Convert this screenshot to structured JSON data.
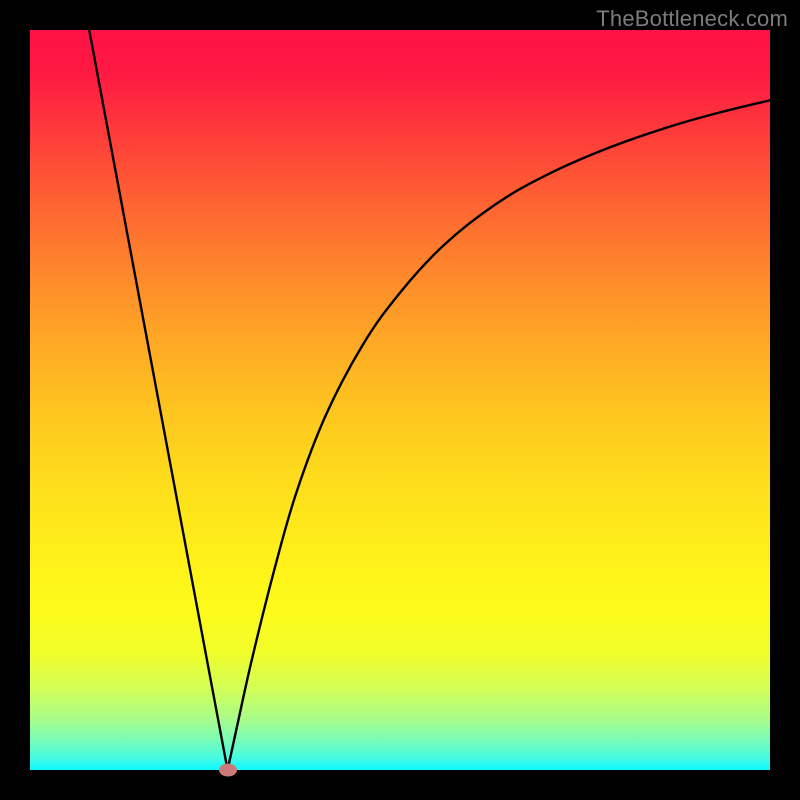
{
  "source_label": "TheBottleneck.com",
  "colors": {
    "frame_bg": "#000000",
    "gradient_top": "#fe1146",
    "gradient_bottom": "#0cf9ff",
    "curve_stroke": "#010000",
    "marker_fill": "#cb7a7b",
    "source_text": "#7c7c7c"
  },
  "chart_data": {
    "type": "line",
    "title": "",
    "xlabel": "",
    "ylabel": "",
    "xlim": [
      0,
      100
    ],
    "ylim": [
      0,
      100
    ],
    "grid": false,
    "series": [
      {
        "name": "left-segment",
        "x": [
          8,
          12,
          16,
          20,
          24,
          26.7
        ],
        "values": [
          100,
          78.6,
          57.2,
          35.8,
          14.4,
          0
        ]
      },
      {
        "name": "right-segment",
        "x": [
          26.7,
          28,
          30,
          33,
          36,
          40,
          45,
          50,
          56,
          63,
          70,
          78,
          86,
          93,
          100
        ],
        "values": [
          0,
          6,
          15,
          27,
          37.5,
          48,
          57.5,
          64.5,
          71,
          76.5,
          80.5,
          84,
          86.8,
          88.8,
          90.5
        ]
      }
    ],
    "annotations": [
      {
        "name": "vertex-marker",
        "x": 26.7,
        "y": 0,
        "kind": "point"
      }
    ],
    "background": {
      "type": "vertical-gradient",
      "description": "red at top through orange/yellow to green/cyan at bottom"
    }
  }
}
